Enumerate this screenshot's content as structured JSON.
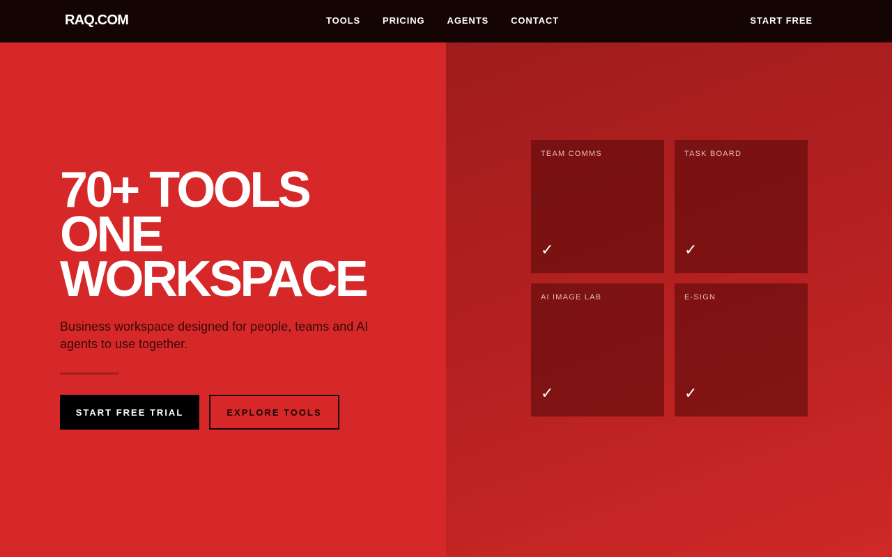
{
  "nav": {
    "logo": "RAQ.COM",
    "links": [
      "TOOLS",
      "PRICING",
      "AGENTS",
      "CONTACT"
    ],
    "cta": "START FREE"
  },
  "hero": {
    "headline_lines": [
      "70+ TOOLS",
      "ONE",
      "WORKSPACE"
    ],
    "subtitle": "Business workspace designed for people, teams and AI agents to use together.",
    "primary_button": "START FREE TRIAL",
    "secondary_button": "EXPLORE TOOLS"
  },
  "tiles": [
    {
      "label": "TEAM COMMS",
      "check": "✓"
    },
    {
      "label": "TASK BOARD",
      "check": "✓"
    },
    {
      "label": "AI IMAGE LAB",
      "check": "✓"
    },
    {
      "label": "E-SIGN",
      "check": "✓"
    }
  ],
  "colors": {
    "brand_red": "#d62828",
    "nav_bg": "#140404",
    "tile_bg": "#6b1111"
  }
}
